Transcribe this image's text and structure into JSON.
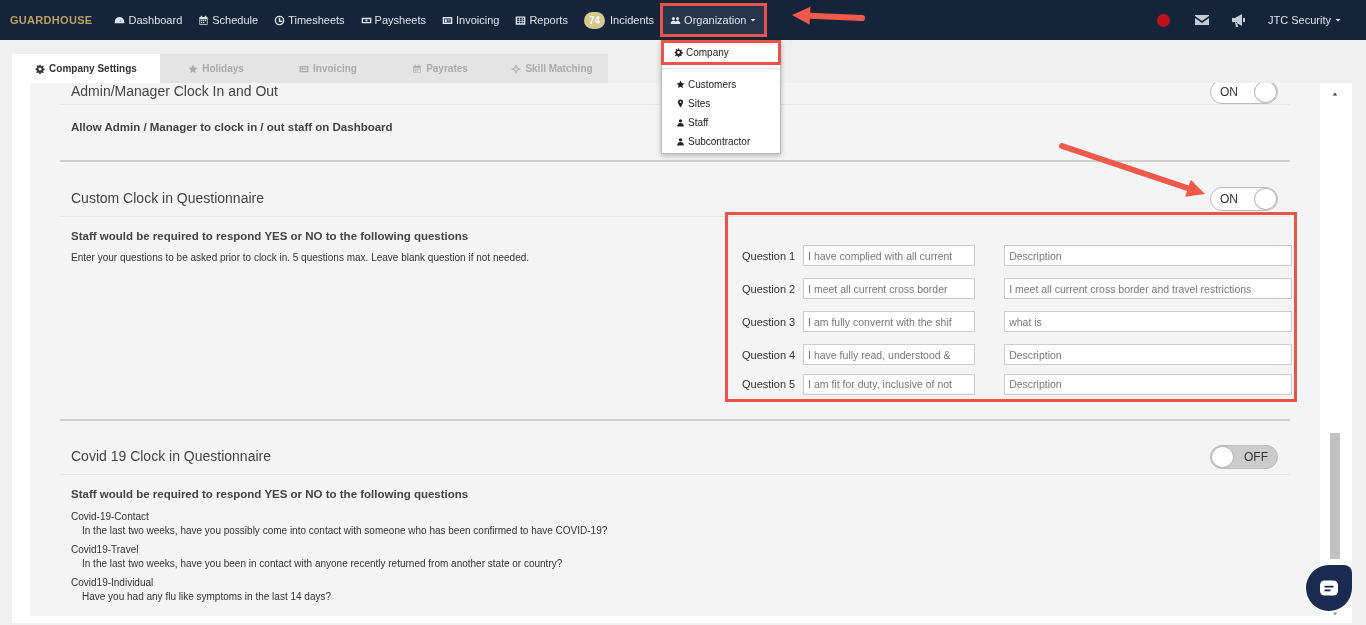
{
  "brand": "GUARDHOUSE",
  "nav": [
    {
      "label": "Dashboard",
      "selected": false,
      "highlighted": false
    },
    {
      "label": "Schedule",
      "selected": false,
      "highlighted": false
    },
    {
      "label": "Timesheets",
      "selected": false,
      "highlighted": false
    },
    {
      "label": "Paysheets",
      "selected": false,
      "highlighted": false
    },
    {
      "label": "Invoicing",
      "selected": false,
      "highlighted": false
    },
    {
      "label": "Reports",
      "selected": false,
      "highlighted": false
    },
    {
      "label": "Incidents",
      "badge": "74",
      "selected": false,
      "highlighted": false
    },
    {
      "label": "Organization",
      "selected": true,
      "highlighted": true
    }
  ],
  "dropdown": {
    "groups": [
      [
        {
          "label": "Company",
          "highlighted": true
        }
      ],
      [
        {
          "label": "Customers",
          "highlighted": false
        },
        {
          "label": "Sites",
          "highlighted": false
        },
        {
          "label": "Staff",
          "highlighted": false
        },
        {
          "label": "Subcontractor",
          "highlighted": false
        }
      ]
    ]
  },
  "user_menu": "JTC Security",
  "tabs": [
    {
      "label": "Company Settings",
      "selected": true
    },
    {
      "label": "Holidays",
      "selected": false
    },
    {
      "label": "Invoicing",
      "selected": false
    },
    {
      "label": "Payrates",
      "selected": false
    },
    {
      "label": "Skill Matching",
      "selected": false
    }
  ],
  "sections": [
    {
      "kind": "plain",
      "title": "Admin/Manager Clock In and Out",
      "on": true,
      "toggle_label": "ON",
      "subtitle": "Allow Admin / Manager to clock in / out staff on Dashboard"
    },
    {
      "kind": "questions",
      "title": "Custom Clock in Questionnaire",
      "on": true,
      "toggle_label": "ON",
      "subtitle": "Staff would be required to respond YES or NO to the following questions",
      "note": "Enter your questions to be asked prior to clock in. 5 questions max. Leave blank question if not needed.",
      "highlighted": true,
      "questions": [
        {
          "label": "Question 1",
          "value": "I have complied with all current",
          "description_placeholder": "Description"
        },
        {
          "label": "Question 2",
          "value": "I meet all current cross border",
          "description": "I meet all current cross border and travel restrictions"
        },
        {
          "label": "Question 3",
          "value": "I am fully convernt with the shif",
          "description": "what is"
        },
        {
          "label": "Question 4",
          "value": "I have fully read, understood &",
          "description_placeholder": "Description"
        },
        {
          "label": "Question 5",
          "value": "I am fit for duty, inclusive of not",
          "description_placeholder": "Description"
        }
      ]
    },
    {
      "kind": "covid",
      "title": "Covid 19 Clock in Questionnaire",
      "on": false,
      "toggle_label": "OFF",
      "subtitle": "Staff would be required to respond YES or NO to the following questions",
      "items": [
        {
          "name": "Covid-19-Contact",
          "text": "In the last two weeks, have you possibly come into contact with someone who has been confirmed to have COVID-19?"
        },
        {
          "name": "Covid19-Travel",
          "text": "In the last two weeks, have you been in contact with anyone recently returned from another state or country?"
        },
        {
          "name": "Covid19-Individual",
          "text": "Have you had any flu like symptoms in the last 14 days?"
        }
      ]
    }
  ]
}
